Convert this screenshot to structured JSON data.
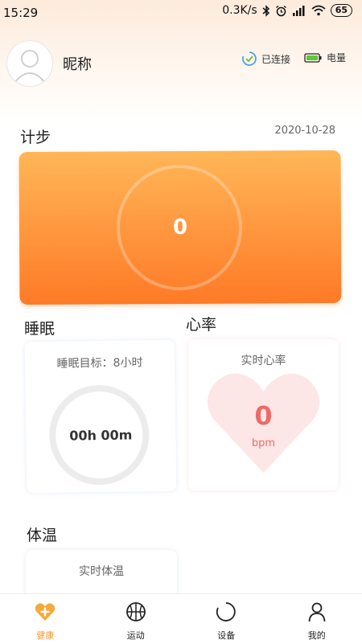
{
  "status_bar": {
    "time": "15:29",
    "net_speed": "0.3K/s",
    "battery": "65"
  },
  "header": {
    "nickname": "昵称",
    "connection_status": "已连接",
    "power_label": "电量"
  },
  "steps": {
    "title": "计步",
    "date": "2020-10-28",
    "value": "0"
  },
  "sleep": {
    "title": "睡眠",
    "goal": "睡眠目标：8小时",
    "value": "00h 00m"
  },
  "heart_rate": {
    "title": "心率",
    "subtitle": "实时心率",
    "value": "0",
    "unit": "bpm"
  },
  "temperature": {
    "title": "体温",
    "subtitle": "实时体温"
  },
  "nav": {
    "items": [
      {
        "label": "健康",
        "icon": "heart-plus-icon",
        "active": true
      },
      {
        "label": "运动",
        "icon": "basketball-icon",
        "active": false
      },
      {
        "label": "设备",
        "icon": "device-ring-icon",
        "active": false
      },
      {
        "label": "我的",
        "icon": "person-icon",
        "active": false
      }
    ]
  },
  "colors": {
    "accent_orange": "#ff9840",
    "heart_red": "#ee6a6a",
    "connected_blue": "#4aa3e6",
    "battery_green": "#5cc83a"
  }
}
